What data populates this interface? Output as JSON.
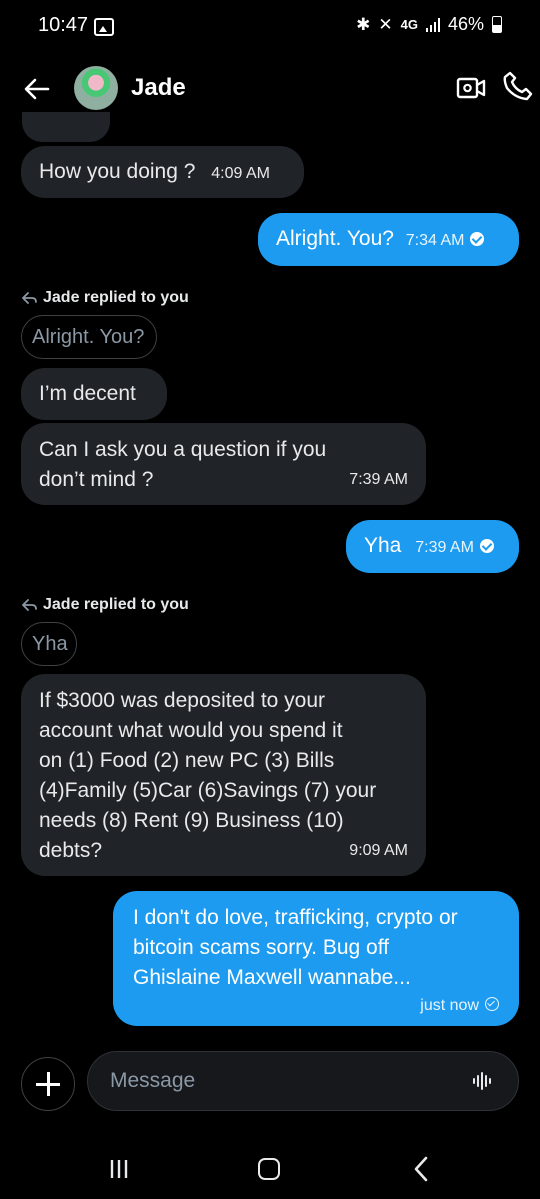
{
  "status_bar": {
    "time": "10:47",
    "network": "4G",
    "battery": "46%"
  },
  "header": {
    "contact_name": "Jade"
  },
  "messages": {
    "m1": {
      "text": "How you doing ?",
      "time": "4:09 AM"
    },
    "m2": {
      "text": "Alright. You?",
      "time": "7:34 AM"
    },
    "reply1": {
      "label": "Jade replied to you",
      "quote": "Alright. You?"
    },
    "m3": {
      "text": "I’m decent"
    },
    "m4": {
      "line1": "Can I ask you a question if you",
      "line2": "don’t mind ?",
      "time": "7:39 AM"
    },
    "m5": {
      "text": "Yha",
      "time": "7:39 AM"
    },
    "reply2": {
      "label": "Jade replied to you",
      "quote": "Yha"
    },
    "m6": {
      "line1": "If $3000 was deposited to your",
      "line2": "account what would you spend it",
      "line3": "on (1) Food  (2) new PC (3) Bills",
      "line4": "(4)Family (5)Car (6)Savings (7) your",
      "line5": "needs (8) Rent (9) Business (10)",
      "line6": "debts?",
      "time": "9:09 AM"
    },
    "m7": {
      "line1": "I don't do love, trafficking, crypto or",
      "line2": "bitcoin scams sorry. Bug off",
      "line3": "Ghislaine Maxwell wannabe...",
      "time": "just now"
    }
  },
  "composer": {
    "placeholder": "Message"
  },
  "colors": {
    "outgoing": "#1d9bf0",
    "incoming": "#202327",
    "background": "#000000"
  },
  "icons": [
    "back-arrow-icon",
    "video-call-icon",
    "phone-icon",
    "plus-icon",
    "voice-message-icon",
    "reply-icon",
    "read-check-icon"
  ]
}
